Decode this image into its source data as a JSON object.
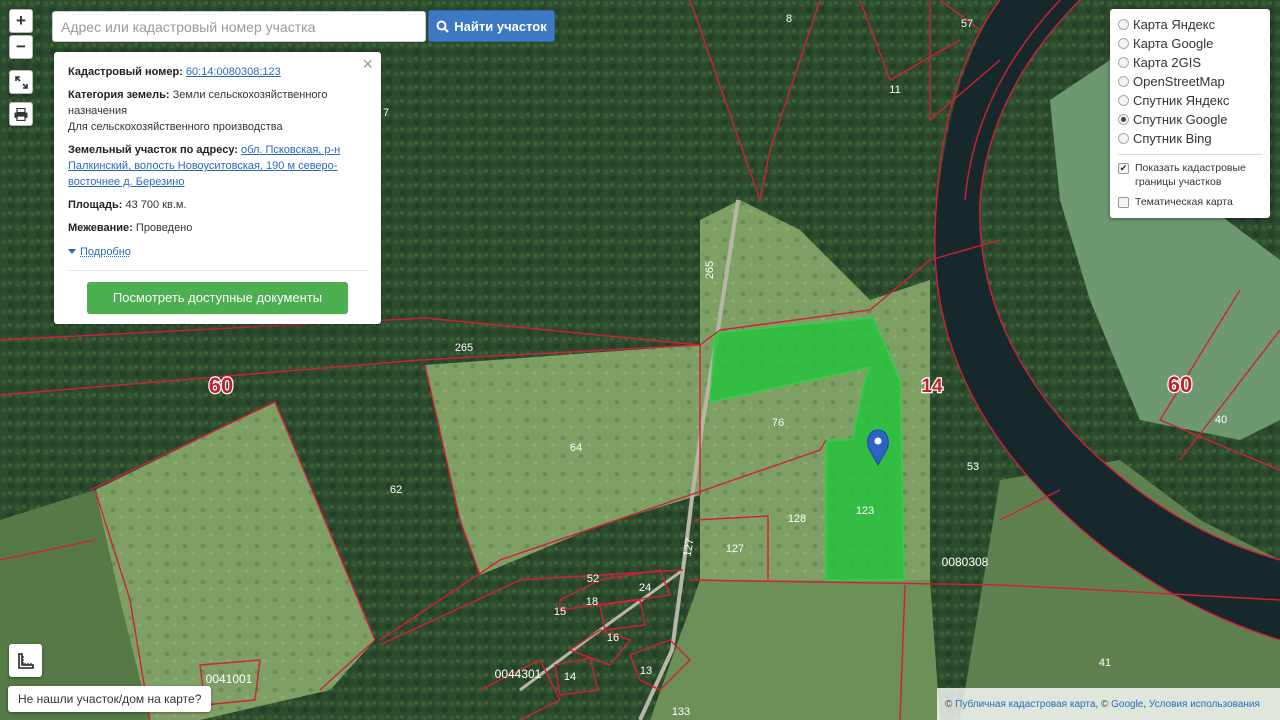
{
  "search": {
    "placeholder": "Адрес или кадастровый номер участка",
    "button_label": "Найти участок"
  },
  "zoom": {
    "in_label": "+",
    "out_label": "−"
  },
  "icons": {
    "search": "search-icon",
    "fullscreen": "fullscreen-icon",
    "print": "print-icon",
    "ruler": "ruler-icon",
    "marker": "map-marker-icon",
    "close": "close-icon"
  },
  "info": {
    "close_label": "×",
    "cadastral_label": "Кадастровый номер:",
    "cadastral_value": "60:14:0080308:123",
    "category_label": "Категория земель:",
    "category_value": "Земли сельскохозяйственного назначения",
    "category_use": "Для сельскохозяйственного производства",
    "address_label": "Земельный участок по адресу:",
    "address_value": "обл. Псковская, р-н Палкинский, волость Новоуситовская, 190 м северо-восточнее д. Березино",
    "area_label": "Площадь:",
    "area_value": "43 700 кв.м.",
    "survey_label": "Межевание:",
    "survey_value": "Проведено",
    "more_label": "Подробно",
    "docs_button": "Посмотреть доступные документы"
  },
  "layers": {
    "options": [
      {
        "label": "Карта Яндекс",
        "selected": false
      },
      {
        "label": "Карта Google",
        "selected": false
      },
      {
        "label": "Карта 2GIS",
        "selected": false
      },
      {
        "label": "OpenStreetMap",
        "selected": false
      },
      {
        "label": "Спутник Яндекс",
        "selected": false
      },
      {
        "label": "Спутник Google",
        "selected": true
      },
      {
        "label": "Спутник Bing",
        "selected": false
      }
    ],
    "show_borders_label": "Показать кадастровые границы участков",
    "show_borders_checked": true,
    "thematic_label": "Тематическая карта",
    "thematic_checked": false
  },
  "map_labels": {
    "region_60_left": "60",
    "region_14": "14",
    "region_60_right": "60",
    "n8": "8",
    "n57": "57",
    "n11": "11",
    "n7": "7",
    "n265_road": "265",
    "n265": "265",
    "n64": "64",
    "n76": "76",
    "n62": "62",
    "n53": "53",
    "n40": "40",
    "n128": "128",
    "n123": "123",
    "n127": "127",
    "n127_road": "127",
    "n0080308": "0080308",
    "n52": "52",
    "n24": "24",
    "n18": "18",
    "n15": "15",
    "n16": "16",
    "n0041001": "0041001",
    "n0044301": "0044301",
    "n14": "14",
    "n13": "13",
    "n133": "133",
    "n41": "41"
  },
  "colors": {
    "selected_parcel": "#22c33a",
    "boundary": "#d0203a",
    "label": "#ffffff",
    "button_blue": "#3c78c3",
    "button_green": "#4caf50"
  },
  "not_found_label": "Не нашли участок/дом на карте?",
  "attribution": {
    "prefix": "©",
    "link1": "Публичная кадастровая карта",
    "sep": ", ©",
    "link2": "Google",
    "comma": ",",
    "link3": "Условия использования"
  }
}
